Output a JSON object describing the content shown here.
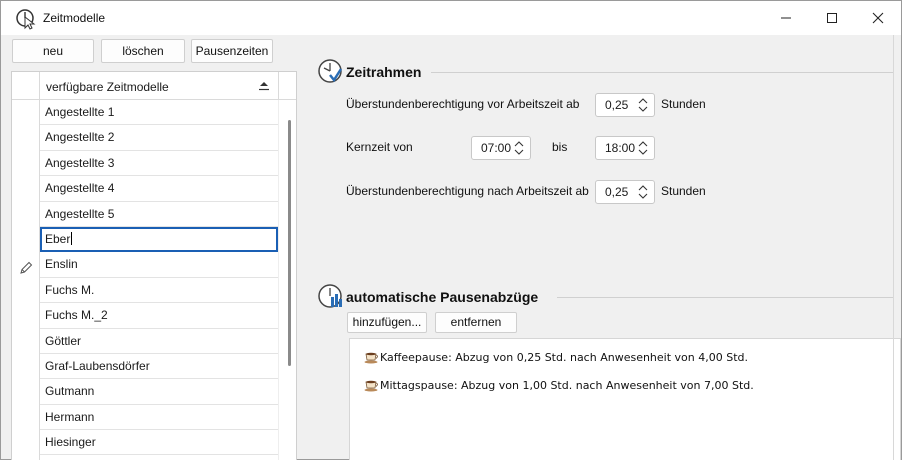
{
  "window": {
    "title": "Zeitmodelle"
  },
  "toolbar": {
    "new_label": "neu",
    "delete_label": "löschen",
    "pauses_label": "Pausenzeiten"
  },
  "list": {
    "header": "verfügbare Zeitmodelle",
    "items": [
      "Angestellte 1",
      "Angestellte 2",
      "Angestellte 3",
      "Angestellte 4",
      "Angestellte 5",
      "Eber",
      "Enslin",
      "Fuchs M.",
      "Fuchs M._2",
      "Göttler",
      "Graf-Laubensdörfer",
      "Gutmann",
      "Hermann",
      "Hiesinger"
    ],
    "editing_index": 5
  },
  "zeitrahmen": {
    "title": "Zeitrahmen",
    "before_label": "Überstundenberechtigung vor Arbeitszeit ab",
    "before_value": "0,25",
    "before_unit": "Stunden",
    "core_label": "Kernzeit von",
    "core_from": "07:00",
    "core_to_label": "bis",
    "core_to": "18:00",
    "after_label": "Überstundenberechtigung nach Arbeitszeit ab",
    "after_value": "0,25",
    "after_unit": "Stunden"
  },
  "pausen": {
    "title": "automatische Pausenabzüge",
    "add_label": "hinzufügen...",
    "remove_label": "entfernen",
    "items": [
      "Kaffeepause: Abzug von 0,25 Std. nach Anwesenheit von 4,00 Std.",
      "Mittagspause: Abzug von 1,00 Std. nach Anwesenheit von 7,00 Std."
    ]
  },
  "colors": {
    "accent": "#1a5fb4",
    "icon_blue": "#2a6db5"
  }
}
